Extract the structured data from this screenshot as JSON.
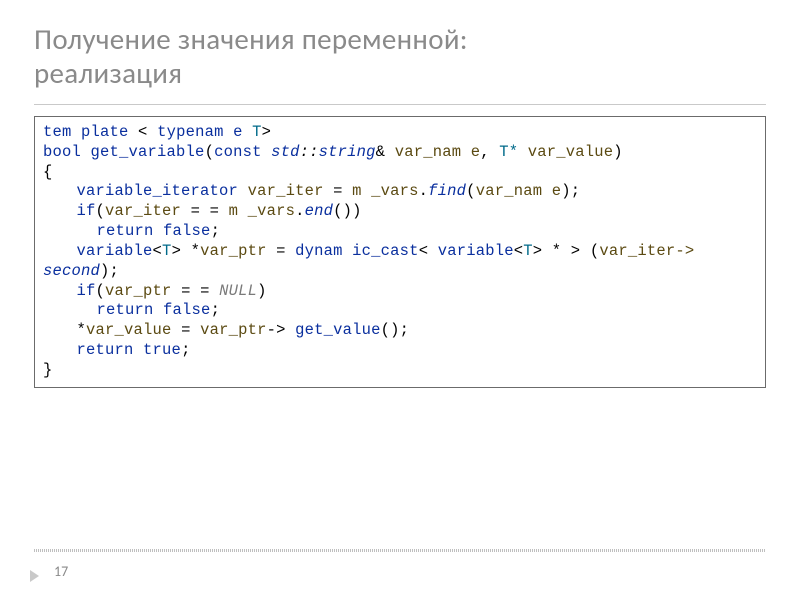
{
  "title_line1": "Получение значения переменной:",
  "title_line2": "реализация",
  "page_number": "17",
  "code": {
    "l1": {
      "template": "tem plate",
      "lt": "<",
      "typename": "typenam e",
      "T": "T",
      "gt": ">"
    },
    "l2": {
      "bool": "bool",
      "fn": "get_variable",
      "op": "(",
      "const": "const",
      "std": "std",
      "dd": "::",
      "string": "string",
      "amp": "&",
      "p1": "var_nam e",
      "c": ",",
      "Tstar": "T*",
      "p2": "var_value",
      "close": ")"
    },
    "l3": "{",
    "l4": {
      "type": "variable_iterator",
      "var": "var_iter",
      "eq": "=",
      "mvars": "m _vars",
      "dot": ".",
      "find": "find",
      "op": "(",
      "arg": "var_nam e",
      "close": ");"
    },
    "l5": {
      "if": "if",
      "op": "(",
      "var": "var_iter",
      "eqeq": "= =",
      "mvars": "m _vars",
      "dot": ".",
      "end": "end",
      "parens": "())"
    },
    "l6": {
      "ret": "return",
      "false": "false",
      "semi": ";"
    },
    "l7": {
      "type1": "variable",
      "lt": "<",
      "T": "T",
      "gt": ">",
      "star": " *",
      "var": "var_ptr",
      "eq": "=",
      "dc": "dynam ic_cast",
      "lt2": "<",
      "type2": "variable",
      "lt3": "<",
      "T2": "T",
      "gt3": ">",
      "starclose": "* >",
      "op": "(",
      "arg": "var_iter",
      "arrow": "->"
    },
    "l7b": {
      "second": "second",
      "close": ");"
    },
    "l8": {
      "if": "if",
      "op": "(",
      "var": "var_ptr",
      "eqeq": "= =",
      "null": "NULL",
      "close": ")"
    },
    "l9": {
      "ret": "return",
      "false": "false",
      "semi": ";"
    },
    "l10": {
      "star": "*",
      "lhs": "var_value",
      "eq": "=",
      "rhs": "var_ptr",
      "arrow": "->",
      "gv": "get_value",
      "parens": "();"
    },
    "l11": {
      "ret": "return",
      "true": "true",
      "semi": ";"
    },
    "l12": "}"
  }
}
